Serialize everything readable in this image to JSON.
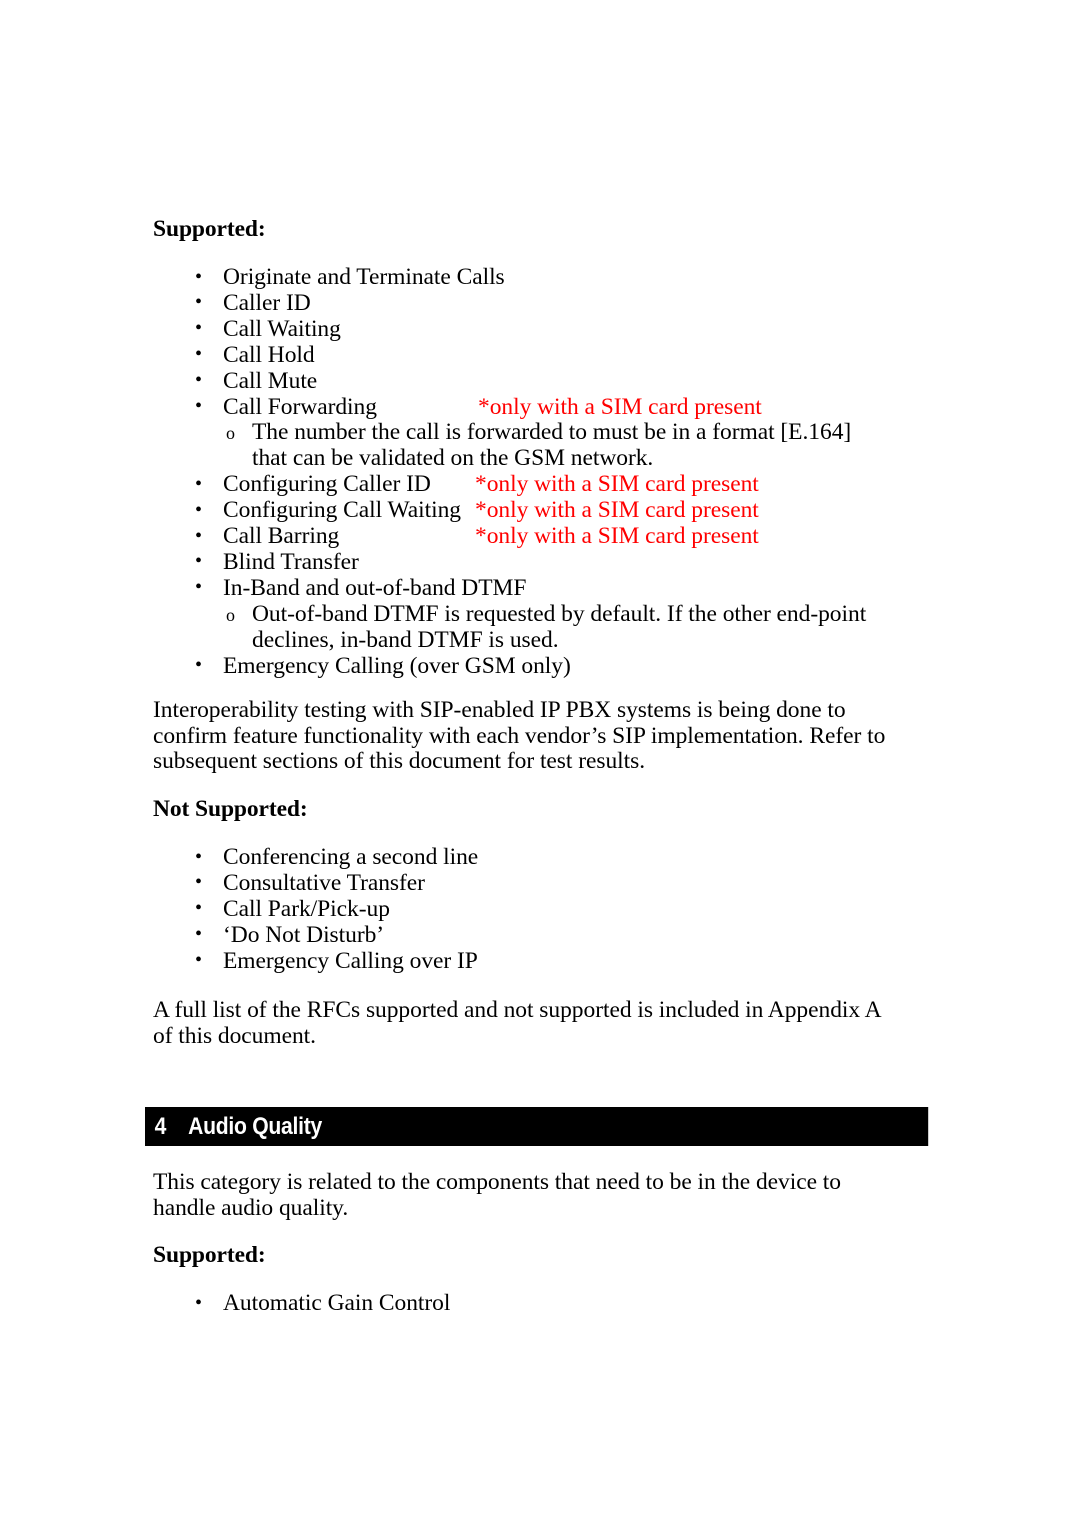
{
  "document": {
    "sections": {
      "supported_heading_1": "Supported:",
      "not_supported_heading": "Not Supported:",
      "supported_heading_2": "Supported:"
    },
    "supported_features": [
      "Originate and Terminate Calls",
      "Caller ID",
      "Call Waiting",
      "Call Hold",
      "Call Mute",
      "Call Forwarding",
      "Configuring Caller ID",
      "Configuring Call Waiting",
      "Call Barring",
      "Blind Transfer",
      "In-Band and out-of-band DTMF",
      "Emergency Calling (over GSM only)"
    ],
    "sim_note": "*only with a SIM card present",
    "sub_notes": {
      "call_forwarding_detail": "The number the call is forwarded to must be in a format [E.164] that can be validated on the GSM network.",
      "dtmf_detail": "Out-of-band DTMF is requested by default. If the other end-point declines, in-band DTMF is used."
    },
    "interop_paragraph": "Interoperability testing with SIP-enabled IP PBX systems is being done to confirm feature functionality with each vendor’s SIP implementation. Refer to subsequent sections of this document for test results.",
    "not_supported_features": [
      "Conferencing a second line",
      "Consultative Transfer",
      "Call Park/Pick-up",
      "‘Do Not Disturb’",
      "Emergency Calling over IP"
    ],
    "rfc_paragraph": "A full list of the RFCs supported and not supported is included in Appendix A of this document.",
    "section_bar": {
      "number": "4",
      "title": "Audio Quality",
      "background_color": "#000000",
      "text_color": "#ffffff"
    },
    "audio_quality_paragraph": "This category is related to the components that need to be in the device to handle audio quality.",
    "audio_quality_supported": [
      "Automatic Gain Control"
    ],
    "colors": {
      "note_red": "#ff0000",
      "body_text": "#000000",
      "page_background": "#ffffff"
    }
  }
}
